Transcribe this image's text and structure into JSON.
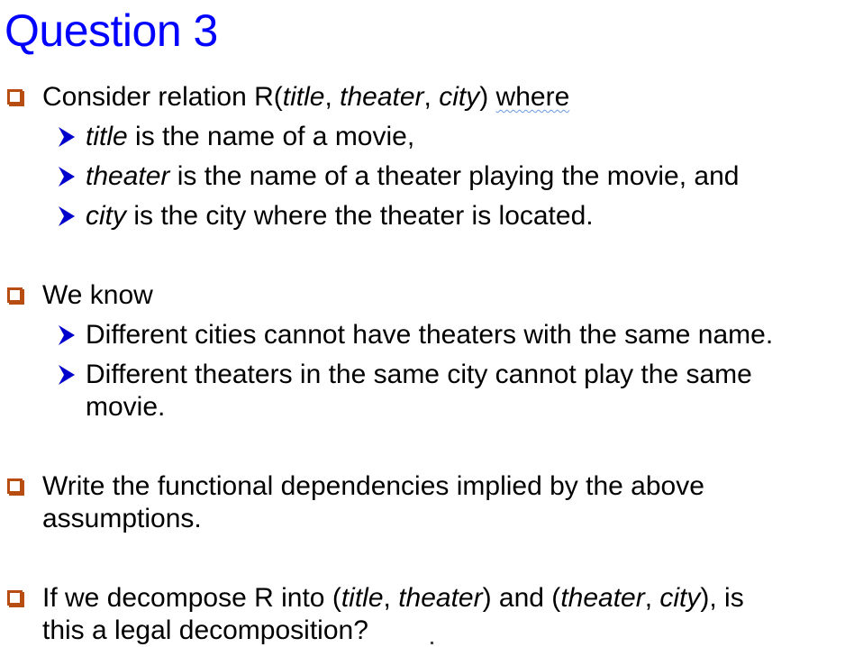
{
  "title": "Question 3",
  "colors": {
    "title": "#0000ff",
    "square_bullet": "#b84d12",
    "arrow_bullet": "#0000cc"
  },
  "q1": {
    "prefix": "Consider relation R(",
    "a1": "title",
    "sep1": ", ",
    "a2": "theater",
    "sep2": ", ",
    "a3": "city",
    "close": ") ",
    "where": "where",
    "sub": [
      {
        "it": "title",
        "rest": " is the name of a movie,"
      },
      {
        "it": "theater",
        "rest": " is the name of a theater playing the movie, and"
      },
      {
        "it": "city",
        "rest": " is the city where the theater is located."
      }
    ]
  },
  "q2": {
    "text": "We know",
    "sub": [
      "Different cities cannot have theaters with the same name.",
      "Different theaters in the same city cannot play the same",
      "movie."
    ]
  },
  "q3": {
    "line1": "Write the functional dependencies implied by the above",
    "line2": "assumptions."
  },
  "q4": {
    "p1": "If we decompose R into (",
    "i1": "title",
    "s1": ", ",
    "i2": "theater",
    "p2": ") and (",
    "i3": "theater",
    "s2": ", ",
    "i4": "city",
    "p3": "), is",
    "line2": "this a legal decomposition?"
  }
}
